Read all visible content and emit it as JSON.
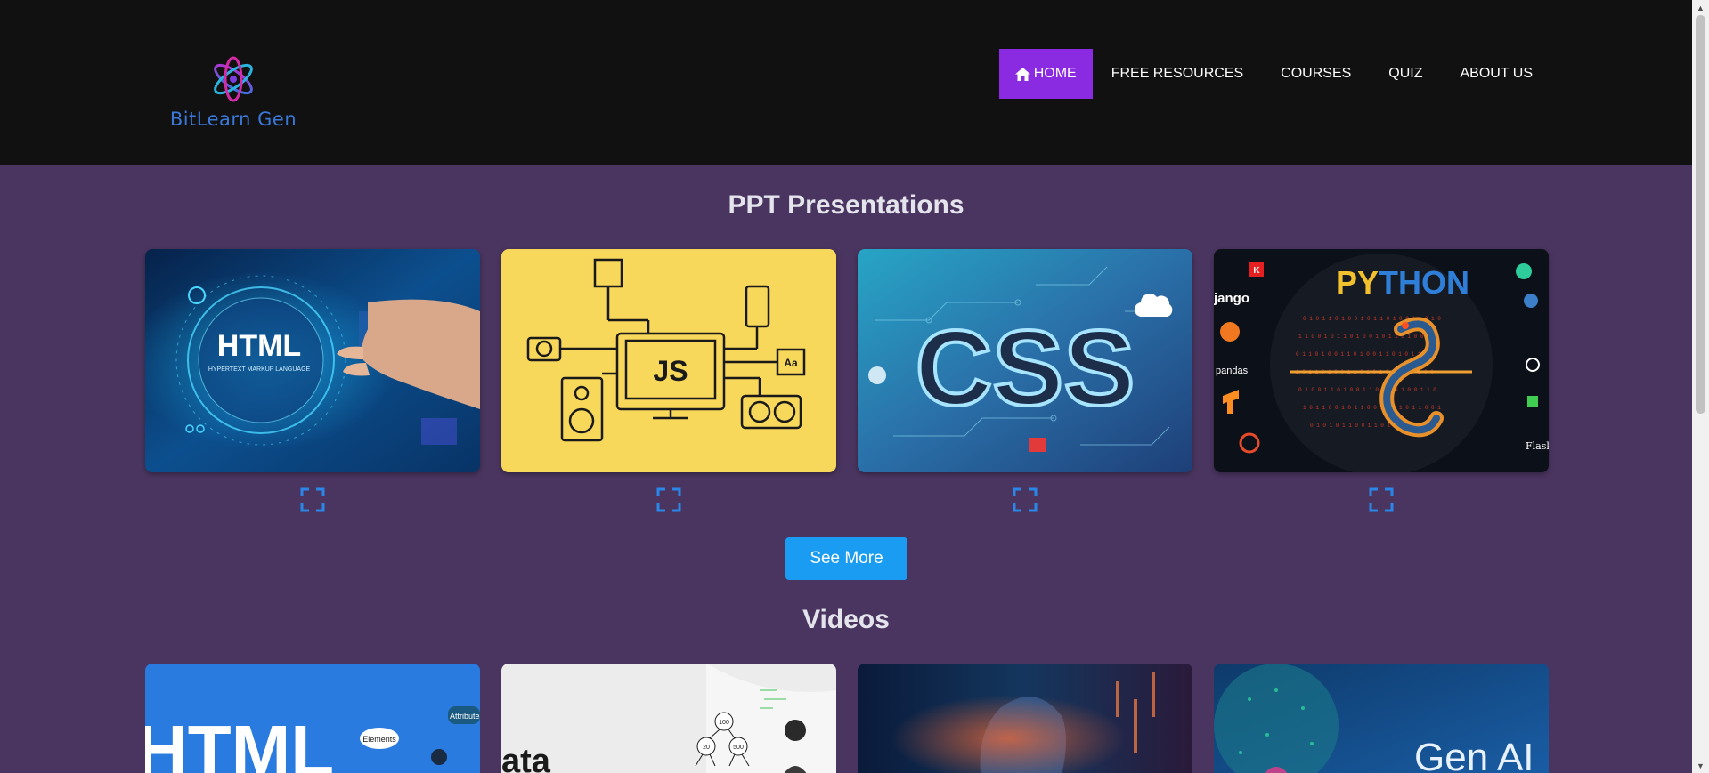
{
  "brand": {
    "name": "BitLearn Gen",
    "logo_icon": "atom-icon",
    "text_color": "#3a78d8"
  },
  "nav": {
    "items": [
      {
        "label": "HOME",
        "icon": "home-icon",
        "active": true
      },
      {
        "label": "FREE RESOURCES",
        "active": false
      },
      {
        "label": "COURSES",
        "active": false
      },
      {
        "label": "QUIZ",
        "active": false
      },
      {
        "label": "ABOUT US",
        "active": false
      }
    ],
    "active_color": "#8a2be2"
  },
  "ppt": {
    "title": "PPT Presentations",
    "cards": [
      {
        "image_text": "HTML",
        "image_subtext": "HYPERTEXT MARKUP LANGUAGE",
        "expand_icon": "expand-icon"
      },
      {
        "image_text": "JS",
        "image_subtext": "Aa",
        "expand_icon": "expand-icon"
      },
      {
        "image_text": "CSS",
        "expand_icon": "expand-icon"
      },
      {
        "image_text_1": "PY",
        "image_text_2": "THON",
        "side_labels": [
          "K",
          "jango",
          "pandas",
          "Flask"
        ],
        "expand_icon": "expand-icon"
      }
    ],
    "see_more": "See More",
    "button_color": "#1a9cf2"
  },
  "videos": {
    "title": "Videos",
    "cards": [
      {
        "image_text": "HTML",
        "bubble_1": "Elements",
        "bubble_2": "Attributes"
      },
      {
        "image_text": "ata",
        "tree_values": [
          "100",
          "20",
          "500"
        ]
      },
      {
        "image_text": ""
      },
      {
        "image_text": "Gen AI"
      }
    ]
  },
  "colors": {
    "background": "#4a3560",
    "header": "#111111",
    "title": "#e4e4ec"
  }
}
